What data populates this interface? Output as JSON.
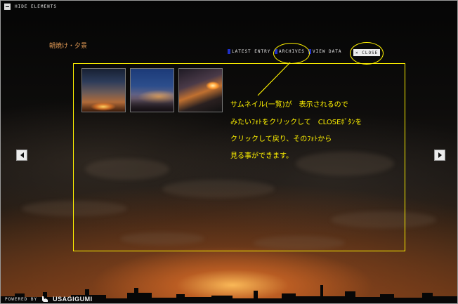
{
  "topbar": {
    "hide_label": "HIDE ELEMENTS"
  },
  "page_title": "朝焼け・夕景",
  "nav": {
    "latest_entry": "LATEST ENTRY",
    "archives": "ARCHIVES",
    "view_data": "VIEW DATA",
    "close": "× CLOSE"
  },
  "thumbnails": [
    {
      "name": "thumbnail-sunset-clouds"
    },
    {
      "name": "thumbnail-city-dusk"
    },
    {
      "name": "thumbnail-highway-sunset"
    }
  ],
  "annotation": {
    "line1": "サムネイル(一覧)が　表示されるので",
    "line2": "みたいﾌｫﾄをクリックして　CLOSEﾎﾞﾀﾝを",
    "line3": "クリックして戻り、そのﾌｫﾄから",
    "line4": "見る事ができます。"
  },
  "footer": {
    "powered_by": "POWERED BY",
    "brand": "USAGIGUMI"
  },
  "colors": {
    "annotation": "#fff200",
    "title": "#e29a55",
    "nav_bullet": "#2030c8"
  },
  "icons": {
    "hide": "minus-square-icon",
    "prev": "left-arrow-icon",
    "next": "right-arrow-icon",
    "brand": "rabbit-logo-icon"
  }
}
